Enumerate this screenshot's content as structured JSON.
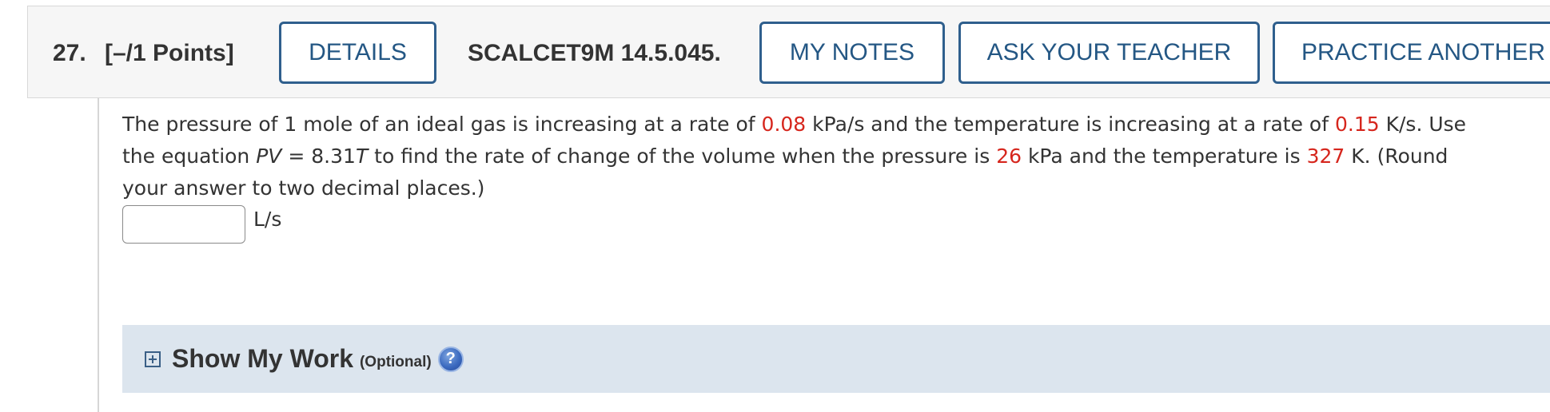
{
  "header": {
    "question_number": "27.",
    "points": "[–/1 Points]",
    "details_label": "DETAILS",
    "problem_code": "SCALCET9M 14.5.045.",
    "my_notes_label": "MY NOTES",
    "ask_teacher_label": "ASK YOUR TEACHER",
    "practice_label": "PRACTICE ANOTHER"
  },
  "question": {
    "line1_a": "The pressure of 1 mole of an ideal gas is increasing at a rate of ",
    "pressure_rate": "0.08",
    "line1_b": " kPa/s and the temperature is increasing at a rate of ",
    "temp_rate": "0.15",
    "line1_c": " K/s. Use",
    "line2_a": "the equation ",
    "eq_pv": "PV",
    "eq_mid": " = 8.31",
    "eq_t": "T",
    "line2_b": " to find the rate of change of the volume when the pressure is ",
    "pressure": "26",
    "line2_c": " kPa and the temperature is ",
    "temperature": "327",
    "line2_d": " K. (Round",
    "line3": "your answer to two decimal places.)"
  },
  "answer": {
    "value": "",
    "unit": "L/s"
  },
  "show_work": {
    "title": "Show My Work",
    "optional": "(Optional)",
    "help_glyph": "?"
  },
  "icons": {
    "expand": "plus-box-icon",
    "help": "question-circle-icon"
  },
  "colors": {
    "accent": "#2f5f8d",
    "highlight": "#d6261d",
    "work_bar": "#dce5ee"
  }
}
